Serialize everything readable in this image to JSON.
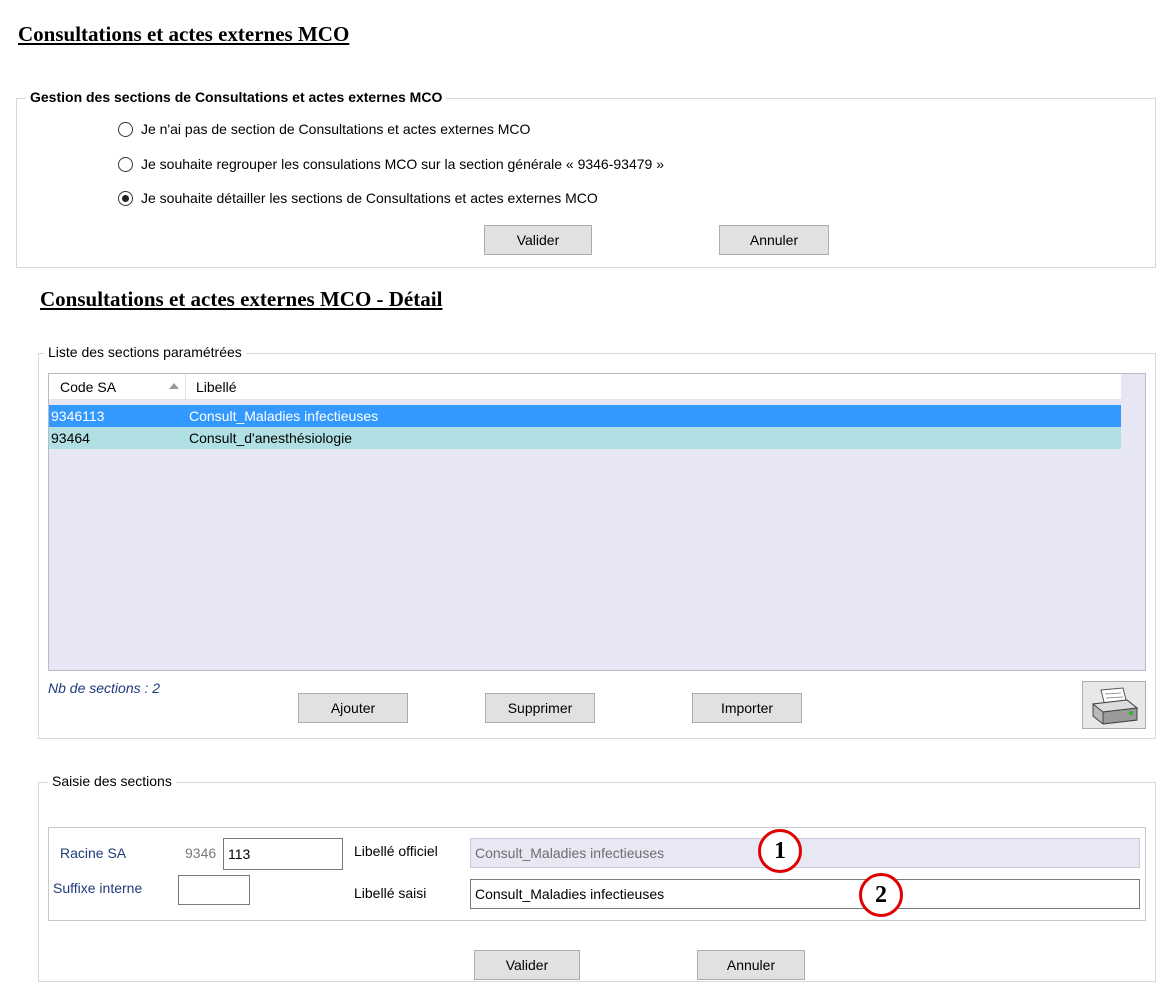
{
  "page_title": "Consultations et actes externes MCO",
  "gestion": {
    "legend": "Gestion des sections de Consultations et actes externes MCO",
    "options": [
      {
        "label": "Je n'ai pas de section de Consultations et actes externes MCO",
        "checked": false
      },
      {
        "label": "Je souhaite regrouper les consulations MCO sur la section générale « 9346-93479 »",
        "checked": false
      },
      {
        "label": "Je souhaite détailler les sections de Consultations et actes externes MCO",
        "checked": true
      }
    ],
    "validate_label": "Valider",
    "cancel_label": "Annuler"
  },
  "detail_title": "Consultations et actes externes MCO - Détail",
  "liste": {
    "legend": "Liste des sections paramétrées",
    "columns": [
      "Code SA",
      "Libellé"
    ],
    "rows": [
      {
        "code": "9346113",
        "libelle": "Consult_Maladies infectieuses",
        "selected": true
      },
      {
        "code": "93464",
        "libelle": "Consult_d'anesthésiologie",
        "selected": false
      }
    ],
    "count_label": "Nb de sections : 2",
    "add_label": "Ajouter",
    "delete_label": "Supprimer",
    "import_label": "Importer",
    "print_icon": "printer-icon"
  },
  "saisie": {
    "legend": "Saisie des sections",
    "racine_label": "Racine SA",
    "racine_prefix": "9346",
    "racine_value": "113",
    "suffixe_label": "Suffixe interne",
    "suffixe_value": "",
    "libelle_officiel_label": "Libellé officiel",
    "libelle_officiel_value": "Consult_Maladies infectieuses",
    "libelle_saisi_label": "Libellé saisi",
    "libelle_saisi_value": "Consult_Maladies infectieuses",
    "validate_label": "Valider",
    "cancel_label": "Annuler"
  },
  "callouts": [
    "1",
    "2"
  ],
  "colors": {
    "selection": "#3399ff",
    "alt_row": "#b0e0e3",
    "list_bg": "#e6e6f5",
    "callout_border": "#e00000",
    "label_blue": "#1f3a7a"
  }
}
